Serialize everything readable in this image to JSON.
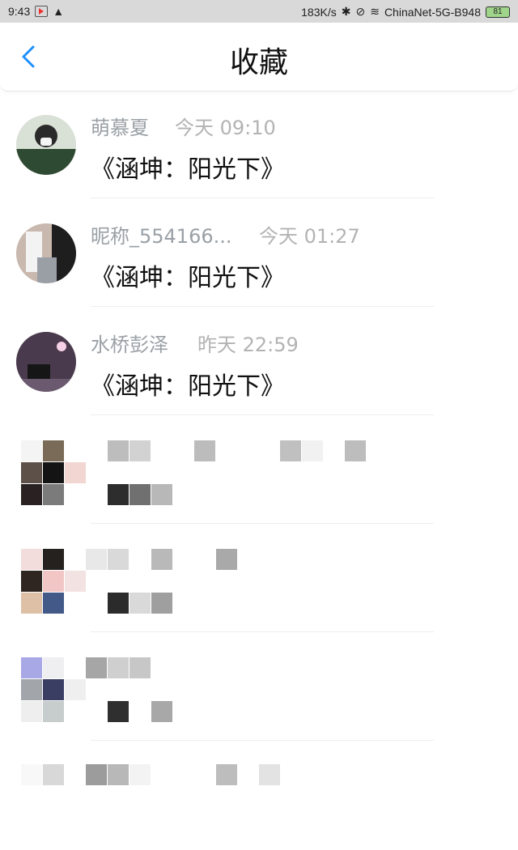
{
  "status": {
    "time": "9:43",
    "speed": "183K/s",
    "network": "ChinaNet-5G-B948",
    "battery": "81"
  },
  "header": {
    "title": "收藏"
  },
  "items": [
    {
      "name": "萌慕夏",
      "time": "今天 09:10",
      "text": "《涵坤：阳光下》"
    },
    {
      "name": "昵称_554166...",
      "time": "今天 01:27",
      "text": "《涵坤：阳光下》"
    },
    {
      "name": "水桥彭泽",
      "time": "昨天 22:59",
      "text": "《涵坤：阳光下》"
    }
  ],
  "icons": {
    "back": "chevron-left-icon"
  },
  "colors": {
    "accent": "#1e90ff",
    "muted": "#9aa0a6",
    "divider": "#eeeeee"
  }
}
